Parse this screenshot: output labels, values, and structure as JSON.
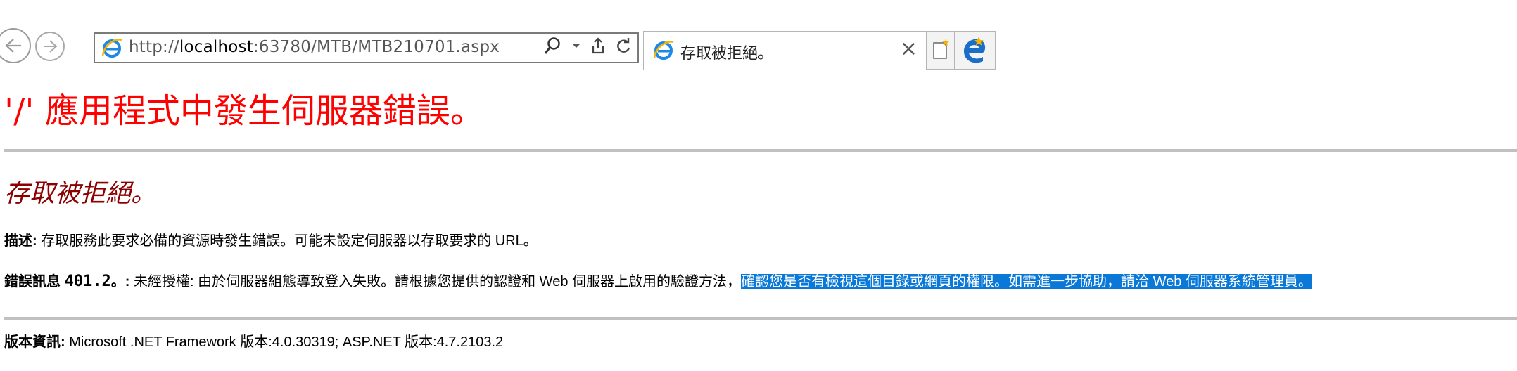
{
  "browser": {
    "url_prefix": "http://",
    "url_host": "localhost",
    "url_path": ":63780/MTB/MTB210701.aspx",
    "tab_title": "存取被拒絕。",
    "tab_close": "×",
    "icons": {
      "back": "back-arrow-icon",
      "forward": "forward-arrow-icon",
      "page": "ie-logo-icon",
      "search": "search-icon",
      "dropdown": "chevron-down-icon",
      "share": "share-icon",
      "refresh": "refresh-icon",
      "new_tab": "new-tab-icon",
      "edge": "edge-logo-icon"
    }
  },
  "page": {
    "heading": "'/' 應用程式中發生伺服器錯誤。",
    "subheading": "存取被拒絕。",
    "description_label": "描述:",
    "description_text": " 存取服務此要求必備的資源時發生錯誤。可能未設定伺服器以存取要求的 URL。",
    "error_label": "錯誤訊息 ",
    "error_code": "401.2",
    "error_suffix": "。: ",
    "error_text": "未經授權: 由於伺服器組態導致登入失敗。請根據您提供的認證和 Web 伺服器上啟用的驗證方法，",
    "error_selected_text": "確認您是否有檢視這個目錄或網頁的權限。如需進一步協助，請洽 Web 伺服器系統管理員。",
    "version_label": "版本資訊:",
    "version_text": " Microsoft .NET Framework 版本:4.0.30319; ASP.NET 版本:4.7.2103.2"
  },
  "colors": {
    "heading": "#ff0000",
    "subheading": "#8b0000",
    "rule": "#c0c0c0",
    "selection": "#0a78d7"
  }
}
